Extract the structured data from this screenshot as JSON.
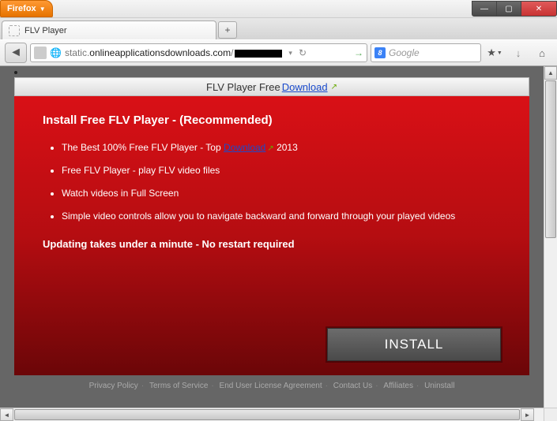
{
  "app": {
    "name": "Firefox"
  },
  "window_controls": {
    "min": "—",
    "max": "▢",
    "close": "✕"
  },
  "tabs": {
    "active": {
      "title": "FLV Player"
    },
    "new_tab": "+"
  },
  "nav": {
    "back": "◄",
    "url_prefix": "static.",
    "url_domain": "onlineapplicationsdownloads.com",
    "url_suffix": "/",
    "go": "→",
    "reload": "↻",
    "chevron": "▾"
  },
  "search": {
    "engine_badge": "8",
    "placeholder": "Google"
  },
  "toolbar_icons": {
    "bookmark": "★",
    "download": "↓",
    "home": "⌂"
  },
  "banner": {
    "text": "FLV Player Free ",
    "link": "Download"
  },
  "main": {
    "heading": "Install Free FLV Player - (Recommended)",
    "bullets": [
      {
        "pre": "The Best 100% Free FLV Player - Top ",
        "link": "Download",
        "post": " 2013"
      },
      {
        "pre": "Free FLV Player - play FLV video files",
        "link": "",
        "post": ""
      },
      {
        "pre": "Watch videos in Full Screen",
        "link": "",
        "post": ""
      },
      {
        "pre": "Simple video controls allow you to navigate backward and forward through your played videos",
        "link": "",
        "post": ""
      }
    ],
    "updating": "Updating takes under a minute - No restart required",
    "install_button": "INSTALL"
  },
  "footer": {
    "links": [
      "Privacy Policy",
      "Terms of Service",
      "End User License Agreement",
      "Contact Us",
      "Affiliates",
      "Uninstall"
    ]
  },
  "scroll_arrows": {
    "up": "▲",
    "down": "▼",
    "left": "◄",
    "right": "►"
  }
}
